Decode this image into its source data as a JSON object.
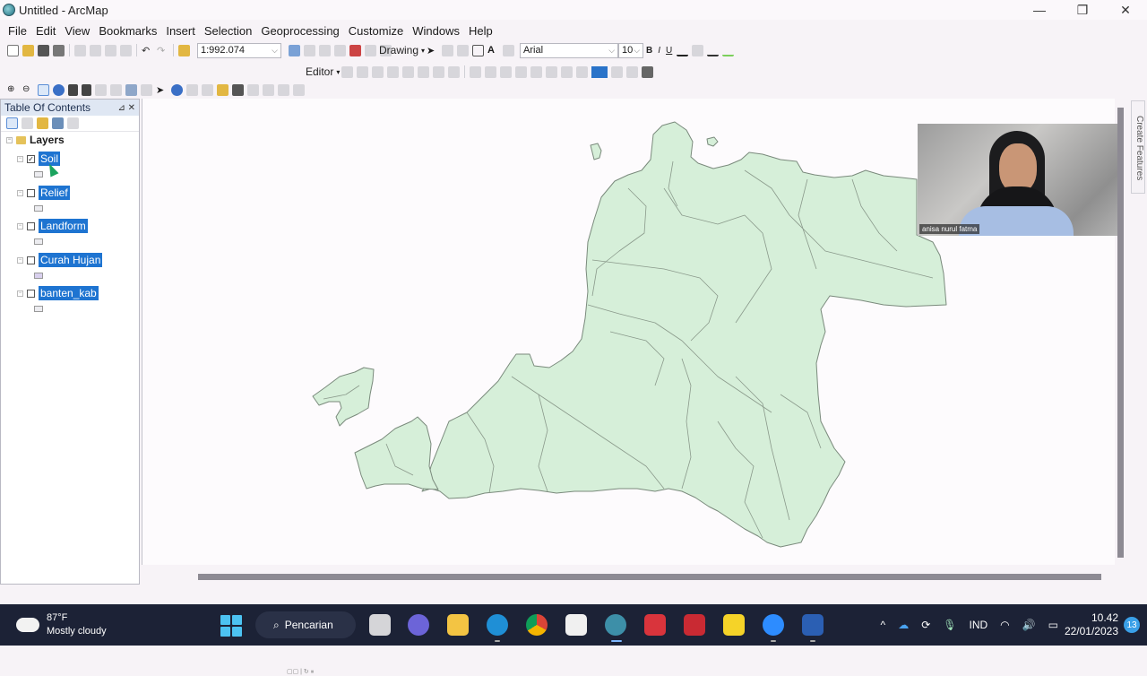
{
  "window": {
    "title": "Untitled - ArcMap",
    "controls": {
      "minimize": "—",
      "maximize": "❐",
      "close": "✕"
    }
  },
  "menu": [
    "File",
    "Edit",
    "View",
    "Bookmarks",
    "Insert",
    "Selection",
    "Geoprocessing",
    "Customize",
    "Windows",
    "Help"
  ],
  "toolbar": {
    "scale": "1:992.074",
    "drawing_label": "Drawing",
    "font_name": "Arial",
    "font_size": "10",
    "bold": "B",
    "italic": "I",
    "underline": "U",
    "editor_label": "Editor",
    "fill_color": "#2a73c9"
  },
  "toc": {
    "title": "Table Of Contents",
    "root": "Layers",
    "layers": [
      {
        "name": "Soil",
        "checked": true,
        "selected": true
      },
      {
        "name": "Relief",
        "checked": false,
        "selected": true
      },
      {
        "name": "Landform",
        "checked": false,
        "selected": true
      },
      {
        "name": "Curah Hujan",
        "checked": false,
        "selected": true
      },
      {
        "name": "banten_kab",
        "checked": false,
        "selected": true
      }
    ]
  },
  "map": {
    "fill_color": "#d6efd9",
    "outline_color": "#7a8a7c",
    "side_tab": "Create Features"
  },
  "webcam": {
    "participant_name": "anisa nurul fatma"
  },
  "taskbar": {
    "weather_temp": "87°F",
    "weather_desc": "Mostly cloudy",
    "search_label": "Pencarian",
    "language": "IND",
    "time": "10.42",
    "date": "22/01/2023",
    "notifications": "13"
  }
}
